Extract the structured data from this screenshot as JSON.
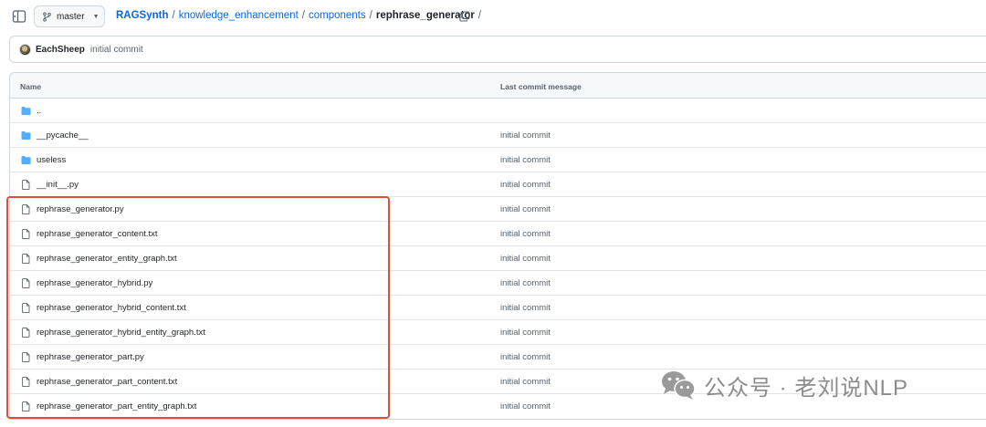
{
  "toolbar": {
    "branch_label": "master",
    "breadcrumb": {
      "repo": "RAGSynth",
      "part1": "knowledge_enhancement",
      "part2": "components",
      "current": "rephrase_generator",
      "separator": "/"
    }
  },
  "commit": {
    "author": "EachSheep",
    "message": "initial commit"
  },
  "table": {
    "col_name": "Name",
    "col_message": "Last commit message",
    "rows": [
      {
        "name": "..",
        "type": "folder",
        "message": ""
      },
      {
        "name": "__pycache__",
        "type": "folder",
        "message": "initial commit"
      },
      {
        "name": "useless",
        "type": "folder",
        "message": "initial commit"
      },
      {
        "name": "__init__.py",
        "type": "file",
        "message": "initial commit"
      },
      {
        "name": "rephrase_generator.py",
        "type": "file",
        "message": "initial commit"
      },
      {
        "name": "rephrase_generator_content.txt",
        "type": "file",
        "message": "initial commit"
      },
      {
        "name": "rephrase_generator_entity_graph.txt",
        "type": "file",
        "message": "initial commit"
      },
      {
        "name": "rephrase_generator_hybrid.py",
        "type": "file",
        "message": "initial commit"
      },
      {
        "name": "rephrase_generator_hybrid_content.txt",
        "type": "file",
        "message": "initial commit"
      },
      {
        "name": "rephrase_generator_hybrid_entity_graph.txt",
        "type": "file",
        "message": "initial commit"
      },
      {
        "name": "rephrase_generator_part.py",
        "type": "file",
        "message": "initial commit"
      },
      {
        "name": "rephrase_generator_part_content.txt",
        "type": "file",
        "message": "initial commit"
      },
      {
        "name": "rephrase_generator_part_entity_graph.txt",
        "type": "file",
        "message": "initial commit"
      }
    ]
  },
  "watermark": {
    "text": "公众号 · 老刘说NLP"
  },
  "colors": {
    "link": "#0969da",
    "folder": "#54aeff",
    "highlight": "#d9503f"
  },
  "icons": {
    "sidebar": "sidebar-toggle-icon",
    "branch": "git-branch-icon",
    "copy": "copy-icon",
    "folder": "folder-icon",
    "file": "file-icon"
  }
}
